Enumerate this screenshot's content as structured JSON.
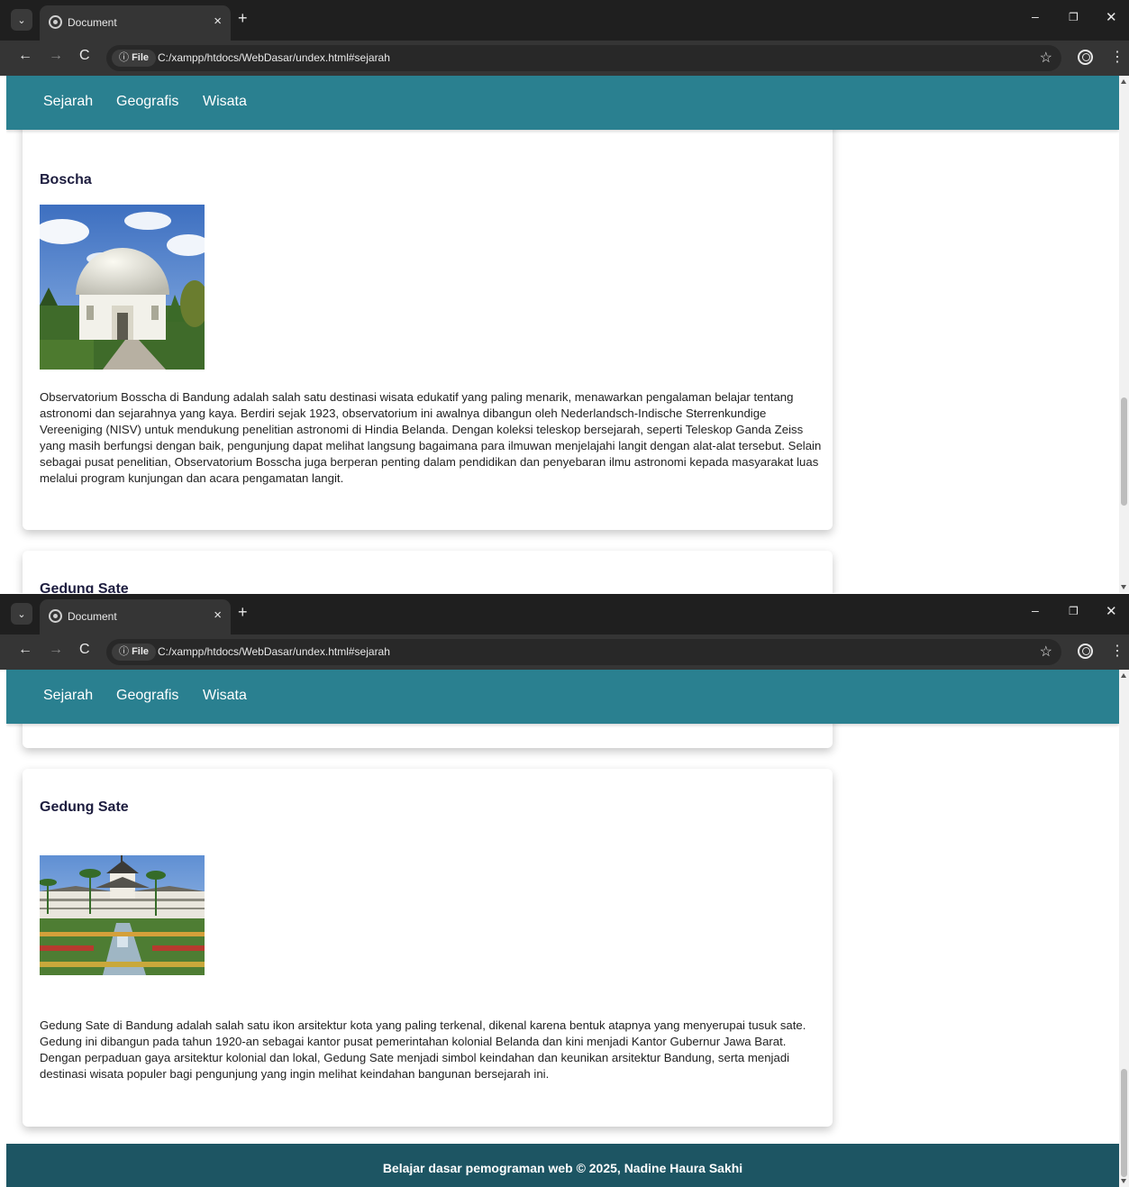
{
  "browser": {
    "tab_title": "Document",
    "tab_close": "×",
    "new_tab": "+",
    "site_chip_icon": "ⓘ",
    "site_chip_label": "File",
    "url": "C:/xampp/htdocs/WebDasar/undex.html#sejarah",
    "star": "☆",
    "win_min": "–",
    "win_close": "✕",
    "menu_dots": "⋮",
    "back": "←",
    "forward": "→",
    "reload": "C"
  },
  "nav": {
    "items": [
      "Sejarah",
      "Geografis",
      "Wisata"
    ]
  },
  "cards": [
    {
      "title": "Boscha",
      "description": "Observatorium Bosscha di Bandung adalah salah satu destinasi wisata edukatif yang paling menarik, menawarkan pengalaman belajar tentang astronomi dan sejarahnya yang kaya. Berdiri sejak 1923, observatorium ini awalnya dibangun oleh Nederlandsch-Indische Sterrenkundige Vereeniging (NISV) untuk mendukung penelitian astronomi di Hindia Belanda. Dengan koleksi teleskop bersejarah, seperti Teleskop Ganda Zeiss yang masih berfungsi dengan baik, pengunjung dapat melihat langsung bagaimana para ilmuwan menjelajahi langit dengan alat-alat tersebut. Selain sebagai pusat penelitian, Observatorium Bosscha juga berperan penting dalam pendidikan dan penyebaran ilmu astronomi kepada masyarakat luas melalui program kunjungan dan acara pengamatan langit."
    },
    {
      "title": "Gedung Sate",
      "description": "Gedung Sate di Bandung adalah salah satu ikon arsitektur kota yang paling terkenal, dikenal karena bentuk atapnya yang menyerupai tusuk sate. Gedung ini dibangun pada tahun 1920-an sebagai kantor pusat pemerintahan kolonial Belanda dan kini menjadi Kantor Gubernur Jawa Barat. Dengan perpaduan gaya arsitektur kolonial dan lokal, Gedung Sate menjadi simbol keindahan dan keunikan arsitektur Bandung, serta menjadi destinasi wisata populer bagi pengunjung yang ingin melihat keindahan bangunan bersejarah ini."
    }
  ],
  "footer": {
    "text": "Belajar dasar pemograman web © 2025, Nadine Haura Sakhi"
  }
}
